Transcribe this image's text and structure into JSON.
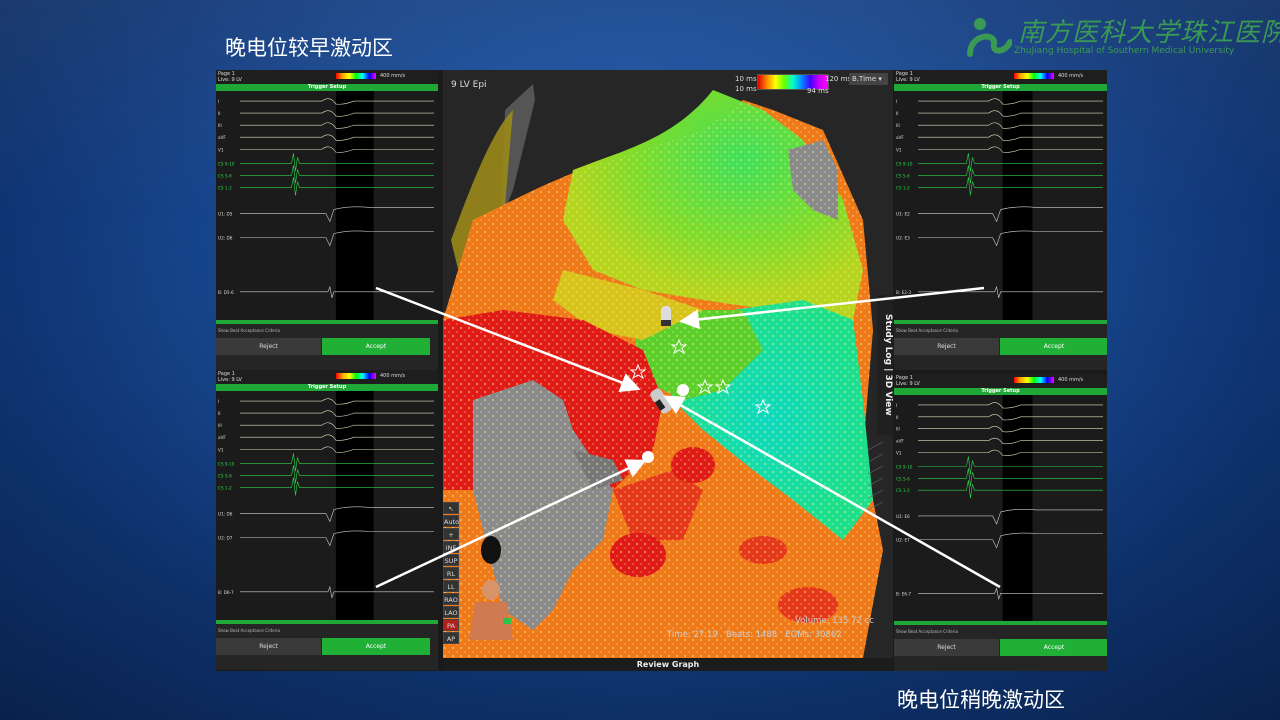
{
  "captions": {
    "top": "晚电位较早激动区",
    "bottom": "晚电位稍晚激动区"
  },
  "logo": {
    "cn": "南方医科大学珠江医院",
    "en": "ZhuJiang Hospital of Southern Medical University",
    "color": "#3a9a53"
  },
  "egm_panels": [
    {
      "id": "tl",
      "page": "Page 1",
      "live": "Live: 9 LV",
      "speed": "400 mm/s",
      "trigger": "Trigger Setup",
      "channels": [
        "I",
        "II",
        "III",
        "aVF",
        "V1",
        "CS 9-10",
        "CS 5-6",
        "CS 1-2",
        "U1: D5",
        "U2: D6",
        "B: D5-6"
      ],
      "criteria": "Show Beat Acceptance Criteria",
      "reject": "Reject",
      "accept": "Accept"
    },
    {
      "id": "bl",
      "page": "Page 1",
      "live": "Live: 9 LV",
      "speed": "400 mm/s",
      "trigger": "Trigger Setup",
      "channels": [
        "I",
        "II",
        "III",
        "aVF",
        "V1",
        "CS 9-10",
        "CS 5-6",
        "CS 1-2",
        "U1: D6",
        "U2: D7",
        "B: D6-7"
      ],
      "criteria": "Show Beat Acceptance Criteria",
      "reject": "Reject",
      "accept": "Accept"
    },
    {
      "id": "tr",
      "page": "Page 1",
      "live": "Live: 9 LV",
      "speed": "400 mm/s",
      "trigger": "Trigger Setup",
      "channels": [
        "I",
        "II",
        "III",
        "aVF",
        "V1",
        "CS 9-10",
        "CS 5-6",
        "CS 1-2",
        "U1: E2",
        "U2: E3",
        "B: E2-3"
      ],
      "criteria": "Show Beat Acceptance Criteria",
      "reject": "Reject",
      "accept": "Accept"
    },
    {
      "id": "br",
      "page": "Page 1",
      "live": "Live: 9 LV",
      "speed": "400 mm/s",
      "trigger": "Trigger Setup",
      "channels": [
        "I",
        "II",
        "III",
        "aVF",
        "V1",
        "CS 9-10",
        "CS 5-6",
        "CS 1-2",
        "U1: E6",
        "U2: E7",
        "B: E6-7"
      ],
      "criteria": "Show Beat Acceptance Criteria",
      "reject": "Reject",
      "accept": "Accept"
    }
  ],
  "map": {
    "title": "9 LV Epi",
    "legend_left_top": "10 ms",
    "legend_left_bottom": "10 ms",
    "legend_right_top": "120 ms",
    "legend_right_bottom": "94 ms",
    "mode": "B.Time",
    "side_tab": "Study Log | 3D View",
    "view_buttons": [
      "Auto",
      "+",
      "INF",
      "SUP",
      "RL",
      "LL",
      "RAO",
      "LAO",
      "PA",
      "AP"
    ],
    "active_view": "PA",
    "volume": "Volume: 135.72 cc",
    "time": "Time: 27:19",
    "beats": "Beats: 1488",
    "egms": "EGMs: 30862",
    "footer": "Review Graph"
  }
}
